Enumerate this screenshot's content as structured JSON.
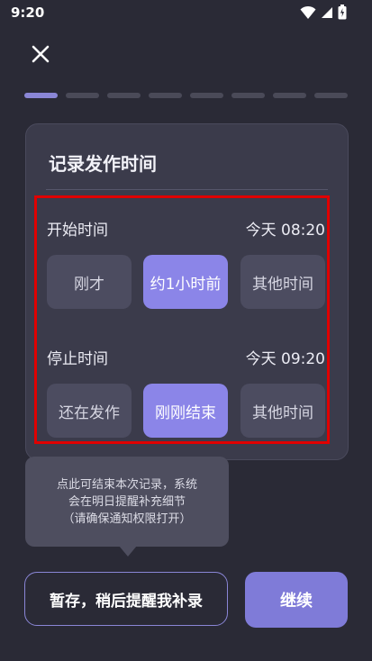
{
  "status_bar": {
    "time": "9:20",
    "icons": [
      "wifi-icon",
      "cell-signal-icon",
      "battery-icon"
    ]
  },
  "header": {
    "close_icon": "close-icon"
  },
  "progress": {
    "total_steps": 8,
    "current_step": 1
  },
  "card": {
    "title": "记录发作时间",
    "start": {
      "label": "开始时间",
      "value": "今天 08:20",
      "options": [
        "刚才",
        "约1小时前",
        "其他时间"
      ],
      "selected_index": 1
    },
    "stop": {
      "label": "停止时间",
      "value": "今天 09:20",
      "options": [
        "还在发作",
        "刚刚结束",
        "其他时间"
      ],
      "selected_index": 1
    }
  },
  "tooltip": {
    "lines": [
      "点此可结束本次记录，系统",
      "会在明日提醒补充细节",
      "（请确保通知权限打开）"
    ]
  },
  "footer": {
    "secondary_label": "暂存，稍后提醒我补录",
    "primary_label": "继续"
  },
  "colors": {
    "background": "#2a2a36",
    "accent": "#8b85e8",
    "card": "#3b3b4b",
    "highlight_box": "#e00000"
  }
}
